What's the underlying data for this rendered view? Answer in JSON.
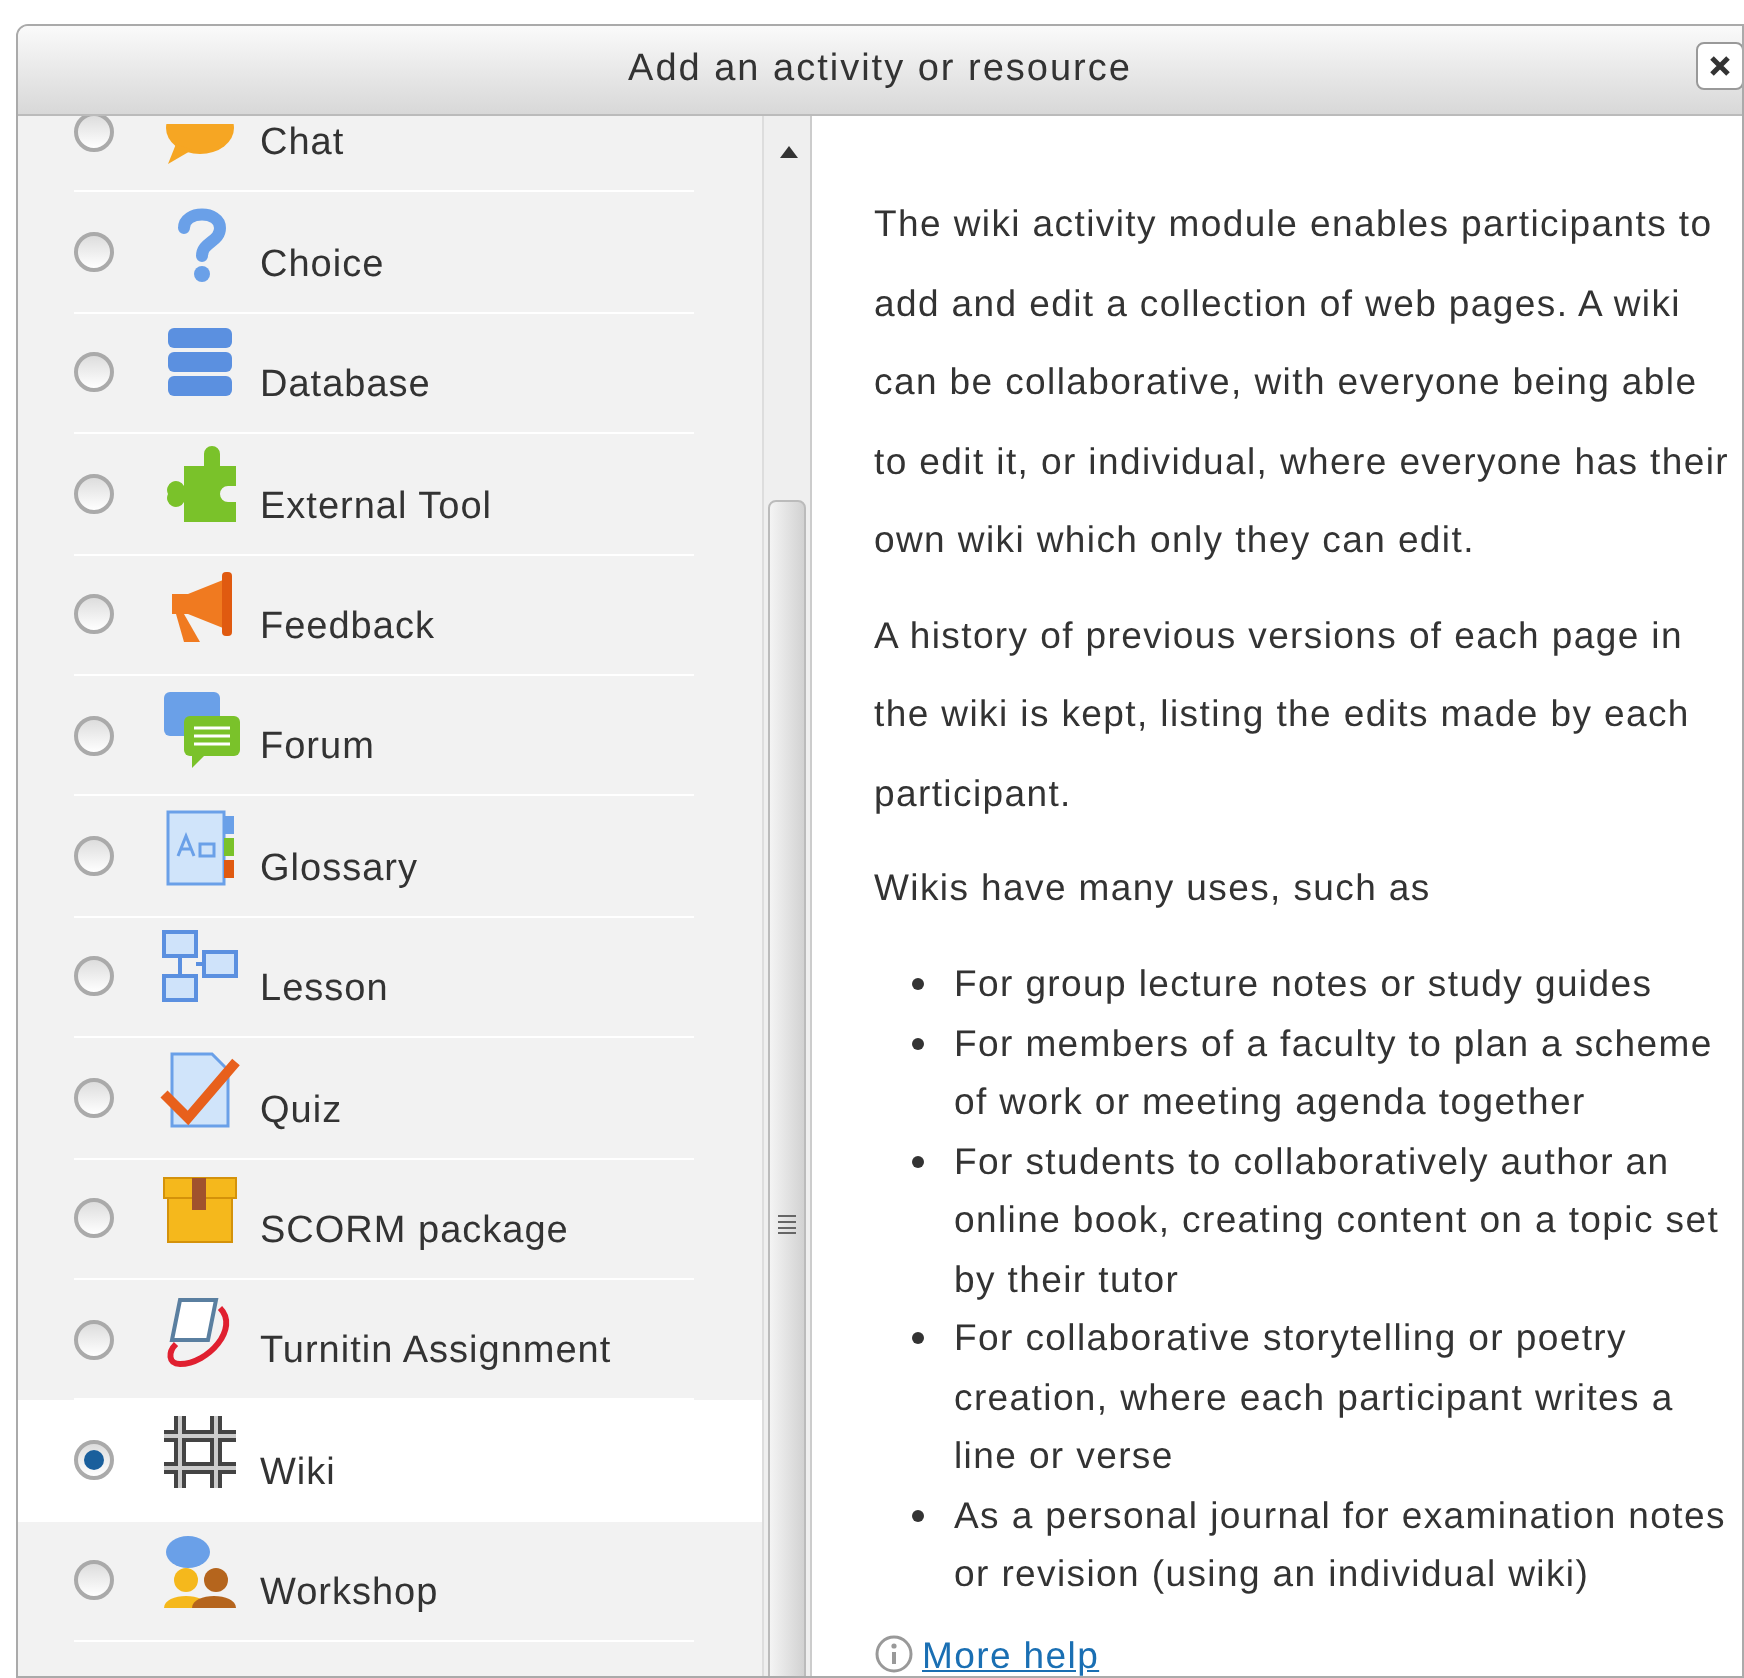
{
  "dialog": {
    "title": "Add an activity or resource"
  },
  "activities": [
    {
      "label": "Chat",
      "kind": "chat",
      "selected": false
    },
    {
      "label": "Choice",
      "kind": "choice",
      "selected": false
    },
    {
      "label": "Database",
      "kind": "database",
      "selected": false
    },
    {
      "label": "External Tool",
      "kind": "tool",
      "selected": false
    },
    {
      "label": "Feedback",
      "kind": "feedback",
      "selected": false
    },
    {
      "label": "Forum",
      "kind": "forum",
      "selected": false
    },
    {
      "label": "Glossary",
      "kind": "glossary",
      "selected": false
    },
    {
      "label": "Lesson",
      "kind": "lesson",
      "selected": false
    },
    {
      "label": "Quiz",
      "kind": "quiz",
      "selected": false
    },
    {
      "label": "SCORM package",
      "kind": "scorm",
      "selected": false
    },
    {
      "label": "Turnitin Assignment",
      "kind": "turnitin",
      "selected": false
    },
    {
      "label": "Wiki",
      "kind": "wiki",
      "selected": true
    },
    {
      "label": "Workshop",
      "kind": "workshop",
      "selected": false
    }
  ],
  "description": {
    "paragraphs": [
      "The wiki activity module enables participants to add and edit a collection of web pages. A wiki can be collaborative, with everyone being able to edit it, or individual, where everyone has their own wiki which only they can edit.",
      "A history of previous versions of each page in the wiki is kept, listing the edits made by each participant.",
      "Wikis have many uses, such as"
    ],
    "bullets": [
      "For group lecture notes or study guides",
      "For members of a faculty to plan a scheme of work or meeting agenda together",
      "For students to collaboratively author an online book, creating content on a topic set by their tutor",
      "For collaborative storytelling or poetry creation, where each participant writes a line or verse",
      "As a personal journal for examination notes or revision (using an individual wiki)"
    ],
    "help_link": "More help"
  }
}
